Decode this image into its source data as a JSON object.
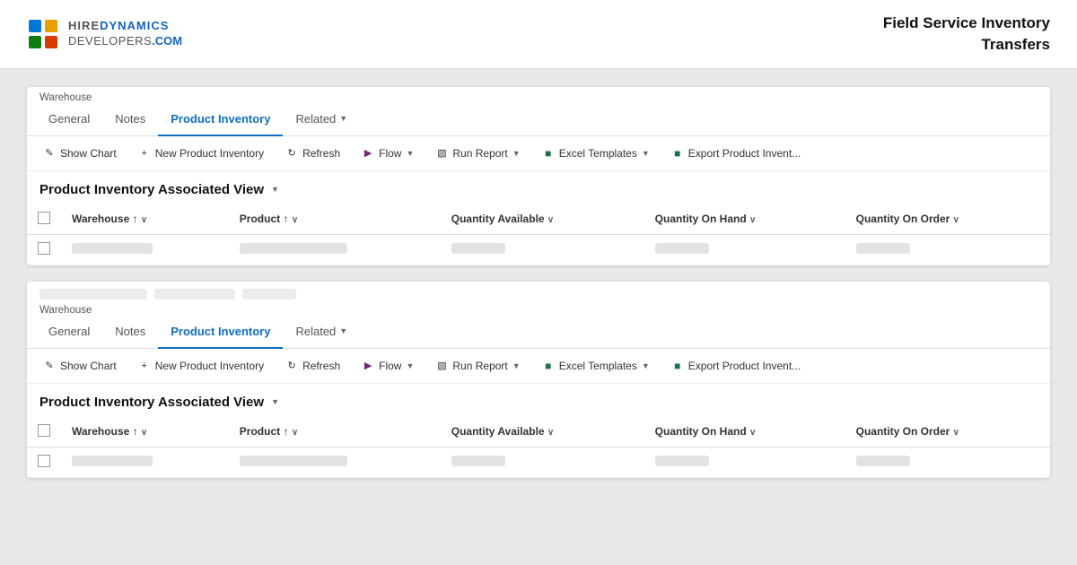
{
  "header": {
    "logo_line1_hire": "HIRE",
    "logo_line1_dynamics": "DYNAMICS",
    "logo_line2_developers": "DEVELOPERS",
    "logo_line2_dotcom": ".COM",
    "title_line1": "Field Service Inventory",
    "title_line2": "Transfers"
  },
  "panel1": {
    "breadcrumb": "Warehouse",
    "tabs": [
      {
        "id": "general",
        "label": "General",
        "active": false
      },
      {
        "id": "notes",
        "label": "Notes",
        "active": false
      },
      {
        "id": "product-inventory",
        "label": "Product Inventory",
        "active": true
      },
      {
        "id": "related",
        "label": "Related",
        "active": false,
        "has_chevron": true
      }
    ],
    "toolbar": {
      "show_chart": "Show Chart",
      "new": "New Product Inventory",
      "refresh": "Refresh",
      "flow": "Flow",
      "run_report": "Run Report",
      "excel_templates": "Excel Templates",
      "export": "Export Product Invent..."
    },
    "view_title": "Product Inventory Associated View",
    "table": {
      "columns": [
        {
          "id": "checkbox",
          "label": ""
        },
        {
          "id": "warehouse",
          "label": "Warehouse ↑ ∨"
        },
        {
          "id": "product",
          "label": "Product ↑ ∨"
        },
        {
          "id": "qty_available",
          "label": "Quantity Available ∨"
        },
        {
          "id": "qty_on_hand",
          "label": "Quantity On Hand ∨"
        },
        {
          "id": "qty_on_order",
          "label": "Quantity On Order ∨"
        }
      ],
      "rows": [
        {
          "warehouse_redacted": true,
          "product_redacted": true,
          "qty_available_redacted": true,
          "qty_on_hand_redacted": true,
          "qty_on_order_redacted": true
        }
      ]
    }
  },
  "panel2": {
    "top_label_redacted": true,
    "breadcrumb": "Warehouse",
    "tabs": [
      {
        "id": "general",
        "label": "General",
        "active": false
      },
      {
        "id": "notes",
        "label": "Notes",
        "active": false
      },
      {
        "id": "product-inventory",
        "label": "Product Inventory",
        "active": true
      },
      {
        "id": "related",
        "label": "Related",
        "active": false,
        "has_chevron": true
      }
    ],
    "toolbar": {
      "show_chart": "Show Chart",
      "new": "New Product Inventory",
      "refresh": "Refresh",
      "flow": "Flow",
      "run_report": "Run Report",
      "excel_templates": "Excel Templates",
      "export": "Export Product Invent..."
    },
    "view_title": "Product Inventory Associated View",
    "table": {
      "columns": [
        {
          "id": "checkbox",
          "label": ""
        },
        {
          "id": "warehouse",
          "label": "Warehouse ↑ ∨"
        },
        {
          "id": "product",
          "label": "Product ↑ ∨"
        },
        {
          "id": "qty_available",
          "label": "Quantity Available ∨"
        },
        {
          "id": "qty_on_hand",
          "label": "Quantity On Hand ∨"
        },
        {
          "id": "qty_on_order",
          "label": "Quantity On Order ∨"
        }
      ],
      "rows": [
        {
          "warehouse_redacted": true,
          "product_redacted": true,
          "qty_available_redacted": true,
          "qty_on_hand_redacted": true,
          "qty_on_order_redacted": true
        }
      ]
    }
  }
}
